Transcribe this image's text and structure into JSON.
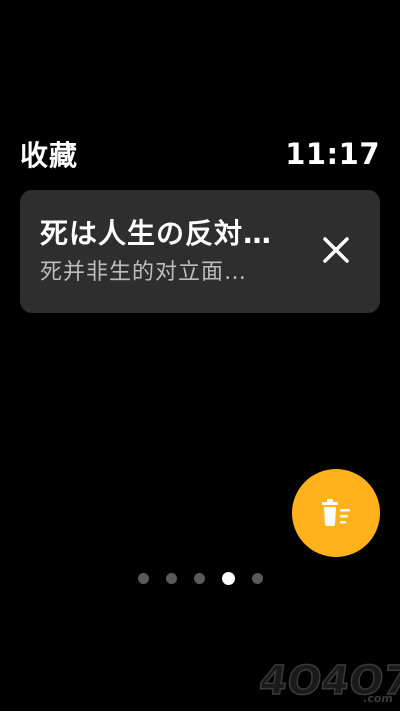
{
  "header": {
    "title": "收藏",
    "time": "11:17"
  },
  "card": {
    "title": "死は人生の反対…",
    "subtitle": "死并非生的对立面…",
    "close_icon": "close-icon"
  },
  "fab": {
    "icon": "delete-list-icon",
    "color": "#ffb21c"
  },
  "pagination": {
    "total": 5,
    "active_index": 3
  },
  "watermark": {
    "text": "4O4O7.com"
  }
}
